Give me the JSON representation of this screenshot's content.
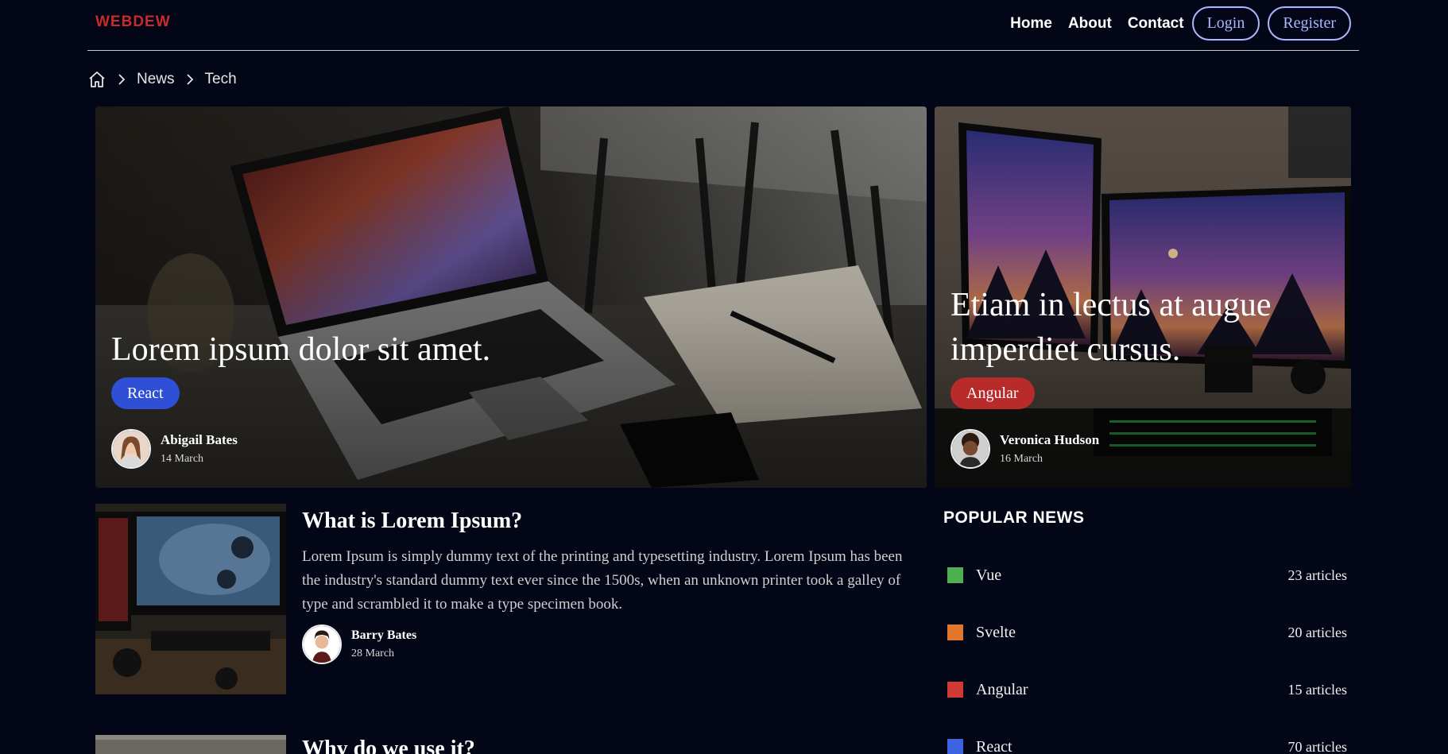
{
  "header": {
    "logo": "WEBDEW",
    "nav": {
      "home": "Home",
      "about": "About",
      "contact": "Contact"
    },
    "login_label": "Login",
    "register_label": "Register"
  },
  "breadcrumb": {
    "items": [
      {
        "label": "News"
      },
      {
        "label": "Tech"
      }
    ]
  },
  "featured": [
    {
      "title": "Lorem ipsum dolor sit amet.",
      "tag": "React",
      "tag_color": "#2f4fd6",
      "author": "Abigail Bates",
      "date": "14 March"
    },
    {
      "title": "Etiam in lectus at augue imperdiet cursus.",
      "tag": "Angular",
      "tag_color": "#b72b2b",
      "author": "Veronica Hudson",
      "date": "16 March"
    }
  ],
  "articles": [
    {
      "title": "What is Lorem Ipsum?",
      "text": "Lorem Ipsum is simply dummy text of the printing and typesetting industry. Lorem Ipsum has been the industry's standard dummy text ever since the 1500s, when an unknown printer took a galley of type and scrambled it to make a type specimen book.",
      "author": "Barry Bates",
      "date": "28 March"
    },
    {
      "title": "Why do we use it?"
    }
  ],
  "popular": {
    "title": "POPULAR NEWS",
    "items": [
      {
        "label": "Vue",
        "count": "23 articles",
        "color": "#4caf50"
      },
      {
        "label": "Svelte",
        "count": "20 articles",
        "color": "#e2762d"
      },
      {
        "label": "Angular",
        "count": "15 articles",
        "color": "#d03a34"
      },
      {
        "label": "React",
        "count": "70 articles",
        "color": "#3d63e0"
      }
    ]
  }
}
